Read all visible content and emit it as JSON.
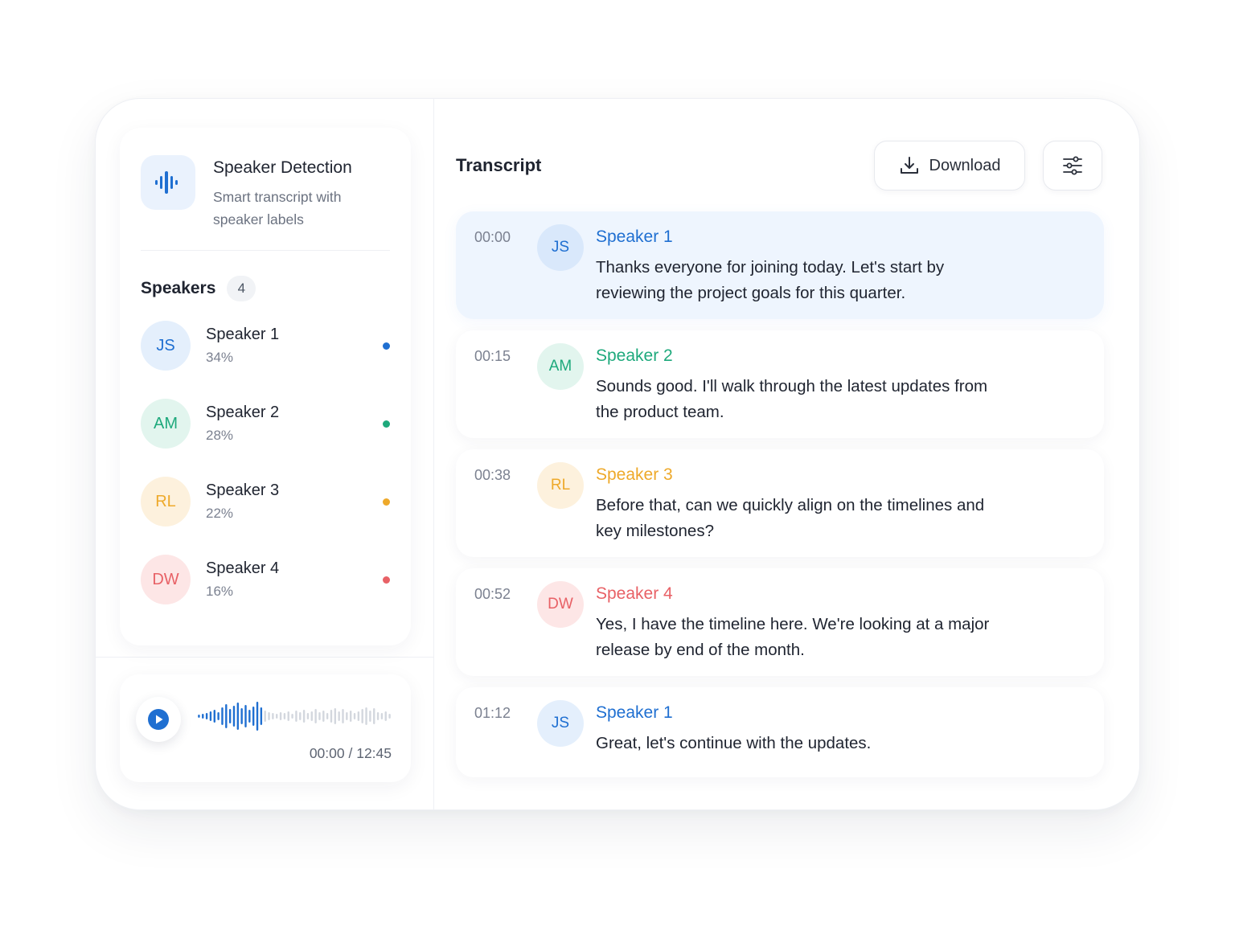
{
  "colors": {
    "speaker1": "#1f6fd1",
    "speaker2": "#1ea97c",
    "speaker3": "#eea92a",
    "speaker4": "#e86166",
    "speaker1_bg": "#e4effc",
    "speaker2_bg": "#e2f5ee",
    "speaker3_bg": "#fdf1dd",
    "speaker4_bg": "#fde6e6",
    "accent": "#1f6fd1"
  },
  "app": {
    "icon": "audio-waveform-icon",
    "title": "Speaker Detection",
    "subtitle": "Smart transcript with speaker labels"
  },
  "speakers": {
    "heading": "Speakers",
    "count": "4",
    "items": [
      {
        "initials": "JS",
        "name": "Speaker 1",
        "percent": "34%"
      },
      {
        "initials": "AM",
        "name": "Speaker 2",
        "percent": "28%"
      },
      {
        "initials": "RL",
        "name": "Speaker 3",
        "percent": "22%"
      },
      {
        "initials": "DW",
        "name": "Speaker 4",
        "percent": "16%"
      }
    ]
  },
  "player": {
    "play_icon": "play-icon",
    "progress": 0.34,
    "time": "00:00 / 12:45"
  },
  "transcript": {
    "title": "Transcript",
    "download_label": "Download",
    "download_icon": "download-icon",
    "settings_icon": "sliders-icon",
    "entries": [
      {
        "time": "00:00",
        "initials": "JS",
        "speaker": "Speaker 1",
        "text": "Thanks everyone for joining today. Let's start by reviewing the project goals for this quarter."
      },
      {
        "time": "00:15",
        "initials": "AM",
        "speaker": "Speaker 2",
        "text": "Sounds good. I'll walk through the latest updates from the product team."
      },
      {
        "time": "00:38",
        "initials": "RL",
        "speaker": "Speaker 3",
        "text": "Before that, can we quickly align on the timelines and key milestones?"
      },
      {
        "time": "00:52",
        "initials": "DW",
        "speaker": "Speaker 4",
        "text": "Yes, I have the timeline here. We're looking at a major release by end of the month."
      },
      {
        "time": "01:12",
        "initials": "JS",
        "speaker": "Speaker 1",
        "text": "Great, let's continue with the updates."
      }
    ]
  }
}
